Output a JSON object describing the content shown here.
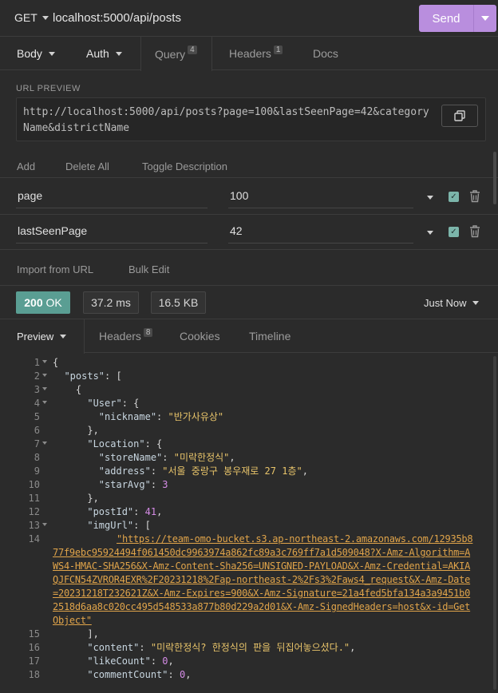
{
  "request": {
    "method": "GET",
    "url": "localhost:5000/api/posts",
    "send_label": "Send"
  },
  "request_tabs": {
    "body": "Body",
    "auth": "Auth",
    "query": "Query",
    "query_count": "4",
    "headers": "Headers",
    "headers_count": "1",
    "docs": "Docs"
  },
  "url_preview": {
    "label": "URL PREVIEW",
    "text": "http://localhost:5000/api/posts?page=100&lastSeenPage=42&categoryName&districtName"
  },
  "param_actions": {
    "add": "Add",
    "delete_all": "Delete All",
    "toggle_description": "Toggle Description"
  },
  "params": [
    {
      "name": "page",
      "value": "100",
      "enabled": true
    },
    {
      "name": "lastSeenPage",
      "value": "42",
      "enabled": true
    }
  ],
  "import_actions": {
    "import_url": "Import from URL",
    "bulk_edit": "Bulk Edit"
  },
  "response": {
    "status_code": "200",
    "status_text": "OK",
    "time": "37.2 ms",
    "size": "16.5 KB",
    "when": "Just Now"
  },
  "response_tabs": {
    "preview": "Preview",
    "headers": "Headers",
    "headers_count": "8",
    "cookies": "Cookies",
    "timeline": "Timeline"
  },
  "code": {
    "l1": "{",
    "l2_key": "\"posts\"",
    "l2_rest": ": [",
    "l3": "{",
    "l4_key": "\"User\"",
    "l4_rest": ": {",
    "l5_key": "\"nickname\"",
    "l5_val": "\"반가사유상\"",
    "l6": "},",
    "l7_key": "\"Location\"",
    "l7_rest": ": {",
    "l8_key": "\"storeName\"",
    "l8_val": "\"미락한정식\"",
    "l9_key": "\"address\"",
    "l9_val": "\"서울 중랑구 봉우재로 27 1층\"",
    "l10_key": "\"starAvg\"",
    "l10_val": "3",
    "l11": "},",
    "l12_key": "\"postId\"",
    "l12_val": "41",
    "l13_key": "\"imgUrl\"",
    "l13_rest": ": [",
    "l14_link": "\"https://team-omo-bucket.s3.ap-northeast-2.amazonaws.com/12935b877f9ebc95924494f061450dc9963974a862fc89a3c769ff7a1d509048?X-Amz-Algorithm=AWS4-HMAC-SHA256&X-Amz-Content-Sha256=UNSIGNED-PAYLOAD&X-Amz-Credential=AKIAQJFCN54ZVROR4EXR%2F20231218%2Fap-northeast-2%2Fs3%2Faws4_request&X-Amz-Date=20231218T232621Z&X-Amz-Expires=900&X-Amz-Signature=21a4fed5bfa134a3a9451b02518d6aa8c020cc495d548533a877b80d229a2d01&X-Amz-SignedHeaders=host&x-id=GetObject\"",
    "l15": "],",
    "l16_key": "\"content\"",
    "l16_val": "\"미락한정식? 한정식의 판을 뒤집어놓으셨다.\"",
    "l17_key": "\"likeCount\"",
    "l17_val": "0",
    "l18_key": "\"commentCount\"",
    "l18_val": "0"
  },
  "colors": {
    "accent": "#b98ede",
    "status_ok": "#5a9e93",
    "string": "#e8c46a",
    "number": "#d58ce6",
    "link": "#e0a44a"
  }
}
